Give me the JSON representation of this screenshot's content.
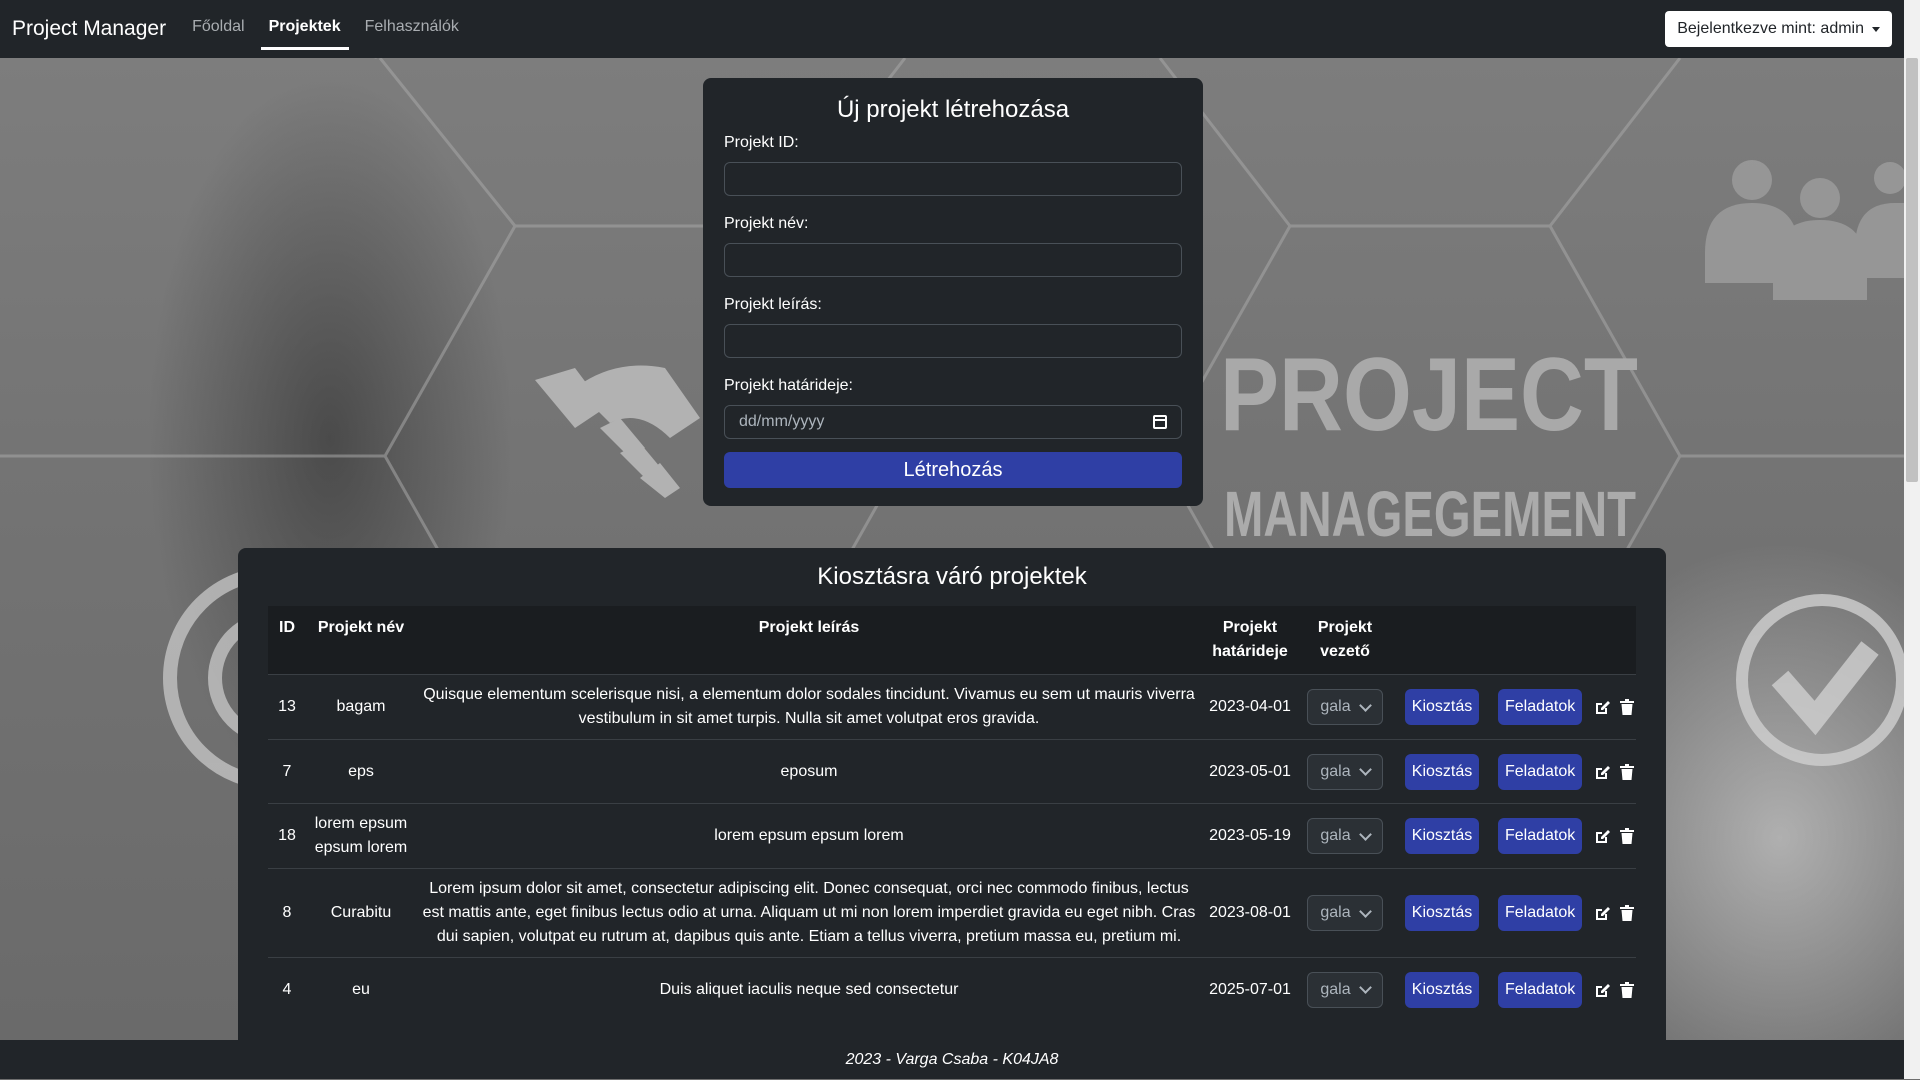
{
  "navbar": {
    "brand": "Project Manager",
    "links": [
      {
        "label": "Főoldal",
        "active": false
      },
      {
        "label": "Projektek",
        "active": true
      },
      {
        "label": "Felhasználók",
        "active": false
      }
    ],
    "user_menu": "Bejelentkezve mint: admin"
  },
  "background": {
    "line1": "PROJECT",
    "line2": "MANAGEGEMENT"
  },
  "form": {
    "title": "Új projekt létrehozása",
    "id_label": "Projekt ID:",
    "name_label": "Projekt név:",
    "desc_label": "Projekt leírás:",
    "deadline_label": "Projekt határideje:",
    "deadline_placeholder": "dd/mm/yyyy",
    "submit": "Létrehozás"
  },
  "table": {
    "title": "Kiosztásra váró projektek",
    "headers": {
      "id": "ID",
      "name": "Projekt név",
      "desc": "Projekt leírás",
      "deadline": "Projekt határideje",
      "leader": "Projekt vezető"
    },
    "assign_label": "Kiosztás",
    "tasks_label": "Feladatok",
    "rows": [
      {
        "id": "13",
        "name": "bagam",
        "desc": "Quisque elementum scelerisque nisi, a elementum dolor sodales tincidunt. Vivamus eu sem ut mauris viverra vestibulum in sit amet turpis. Nulla sit amet volutpat eros gravida.",
        "deadline": "2023-04-01",
        "leader": "gala"
      },
      {
        "id": "7",
        "name": "eps",
        "desc": "eposum",
        "deadline": "2023-05-01",
        "leader": "gala"
      },
      {
        "id": "18",
        "name": "lorem epsum epsum lorem",
        "desc": "lorem epsum epsum lorem",
        "deadline": "2023-05-19",
        "leader": "gala"
      },
      {
        "id": "8",
        "name": "Curabitu",
        "desc": "Lorem ipsum dolor sit amet, consectetur adipiscing elit. Donec consequat, orci nec commodo finibus, lectus est mattis ante, eget finibus lectus odio at urna. Aliquam ut mi non lorem imperdiet gravida eu eget nibh. Cras dui sapien, volutpat eu rutrum at, dapibus quis ante. Etiam a tellus viverra, pretium massa eu, pretium mi.",
        "deadline": "2023-08-01",
        "leader": "gala"
      },
      {
        "id": "4",
        "name": "eu",
        "desc": "Duis aliquet iaculis neque sed consectetur",
        "deadline": "2025-07-01",
        "leader": "gala"
      }
    ]
  },
  "footer": "2023 - Varga Csaba - K04JA8",
  "colors": {
    "navbar": "#212529",
    "card": "#212529",
    "primary_button": "#2f3fa5"
  }
}
